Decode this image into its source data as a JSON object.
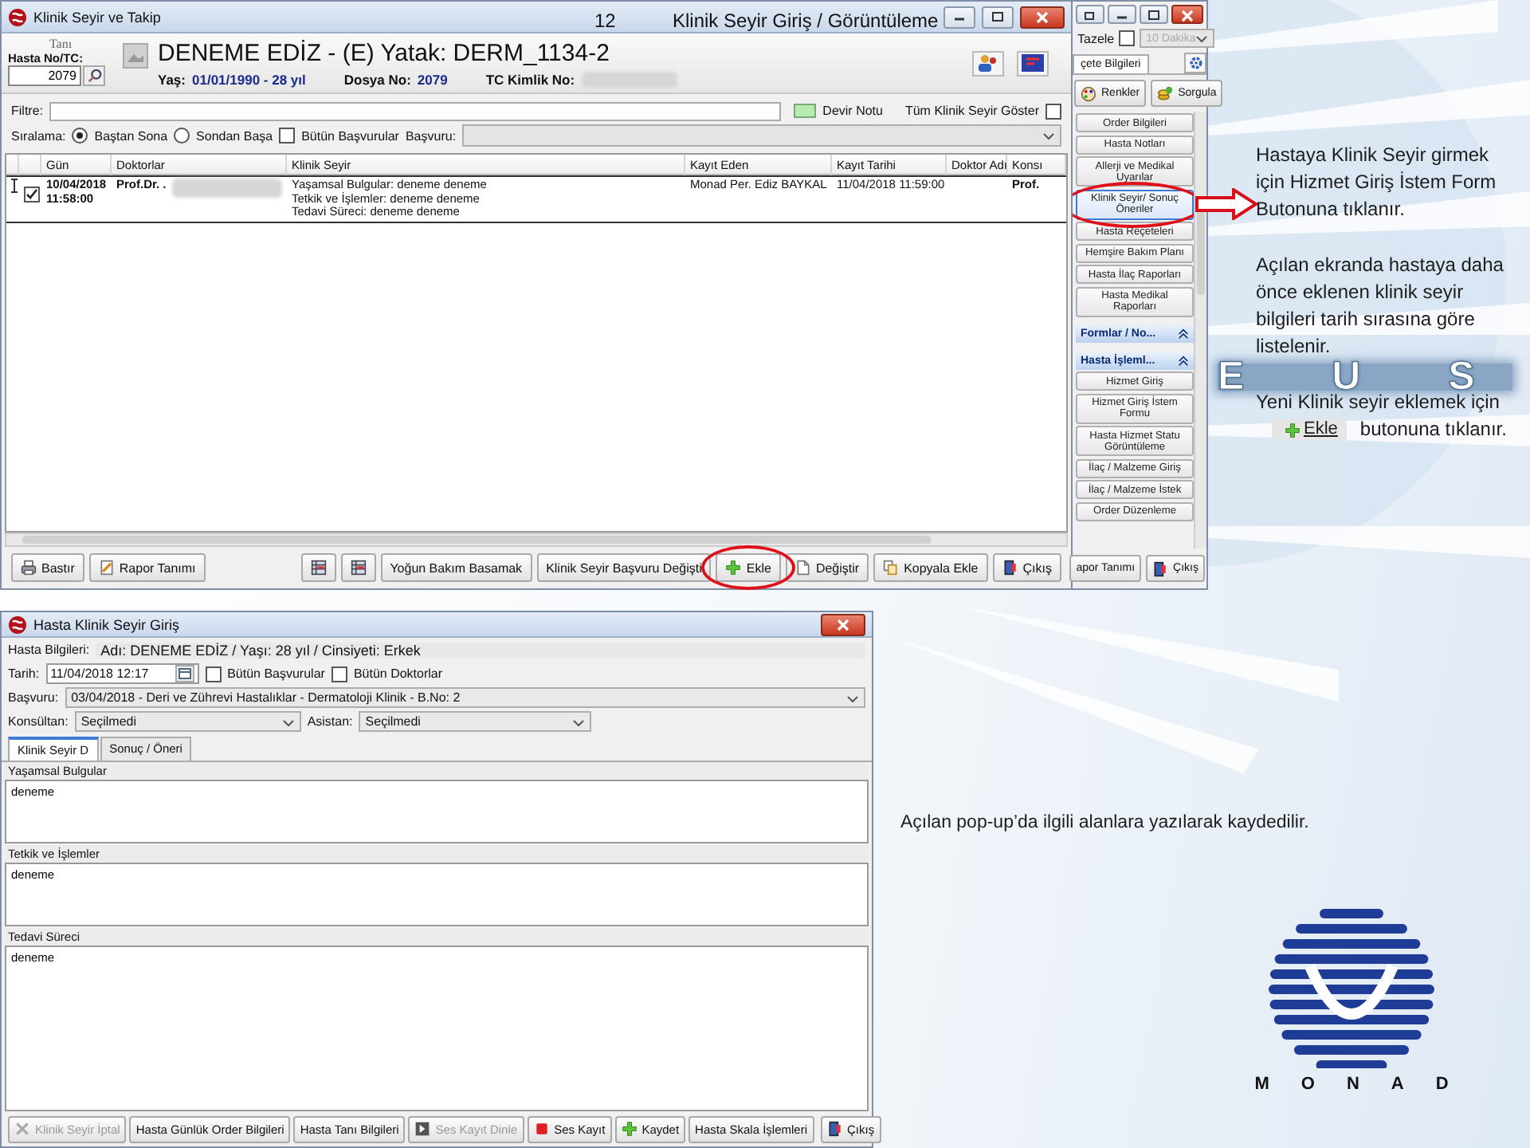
{
  "slide": {
    "number": "12",
    "title": "Klinik Seyir Giriş / Görüntüleme",
    "background_letters": "E U S"
  },
  "main_window": {
    "title": "Klinik Seyir ve Takip",
    "header": {
      "diagnosis_label": "Tanı",
      "patient_no_label": "Hasta No/TC:",
      "patient_no": "2079",
      "patient_title": "DENEME EDİZ - (E) Yatak: DERM_1134-2",
      "info": [
        {
          "label": "Yaş:",
          "value": "01/01/1990 - 28 yıl",
          "redacted": false
        },
        {
          "label": "Dosya No:",
          "value": "2079",
          "redacted": false
        },
        {
          "label": "TC Kimlik No:",
          "redacted": true
        }
      ]
    },
    "filter": {
      "label": "Filtre:",
      "legend": "Devir Notu",
      "show_all": {
        "label": "Tüm Klinik Seyir Göster",
        "checked": false
      }
    },
    "sort": {
      "label": "Sıralama:",
      "options": [
        {
          "label": "Baştan Sona",
          "selected": true
        },
        {
          "label": "Sondan Başa",
          "selected": false
        }
      ],
      "all_applications": {
        "label": "Bütün Başvurular",
        "checked": false
      },
      "application_label": "Başvuru:"
    },
    "table": {
      "columns": [
        "Gün",
        "Doktorlar",
        "Klinik Seyir",
        "Kayıt Eden",
        "Kayıt Tarihi",
        "Doktor Adı",
        "Konsı"
      ],
      "rows": [
        {
          "selected": true,
          "checked": true,
          "day": "10/04/2018 11:58:00",
          "doctor": "Prof.Dr. .",
          "doctor_redacted": true,
          "course": [
            "Yaşamsal Bulgular: deneme deneme",
            "Tetkik ve İşlemler: deneme deneme",
            "Tedavi Süreci: deneme deneme"
          ],
          "recorded_by": "Monad Per. Ediz BAYKAL",
          "record_date": "11/04/2018 11:59:00",
          "consultant": "Prof."
        }
      ]
    },
    "toolbar": [
      {
        "kind": "button",
        "label": "Bastır",
        "highlighted": false
      },
      {
        "kind": "button",
        "label": "Rapor Tanımı",
        "highlighted": false
      },
      {
        "kind": "spacer"
      },
      {
        "kind": "icon_button",
        "highlighted": false
      },
      {
        "kind": "icon_button",
        "highlighted": false
      },
      {
        "kind": "button",
        "label": "Yoğun Bakım Basamak",
        "highlighted": false
      },
      {
        "kind": "button",
        "label": "Klinik Seyir Başvuru Değişti",
        "highlighted": false
      },
      {
        "kind": "button",
        "label": "Ekle",
        "highlighted": true
      },
      {
        "kind": "button",
        "label": "Değiştir",
        "highlighted": false
      },
      {
        "kind": "button",
        "label": "Kopyala Ekle",
        "highlighted": false
      },
      {
        "kind": "button",
        "label": "Çıkış",
        "highlighted": false
      }
    ]
  },
  "side_panel": {
    "refresh_label": "Tazele",
    "refresh_checked": false,
    "interval": "10 Dakika",
    "interval_disabled": true,
    "tab": "çete Bilgileri",
    "buttons": [
      {
        "label": "Renkler"
      },
      {
        "label": "Sorgula"
      }
    ],
    "items": [
      {
        "kind": "button",
        "label": "Order Bilgileri",
        "highlighted": false
      },
      {
        "kind": "button",
        "label": "Hasta Notları",
        "highlighted": false
      },
      {
        "kind": "button",
        "label": "Allerji ve Medikal Uyarılar",
        "highlighted": false
      },
      {
        "kind": "button",
        "label": "Klinik Seyir/ Sonuç Öneriler",
        "highlighted": true
      },
      {
        "kind": "button",
        "label": "Hasta Reçeteleri",
        "highlighted": false
      },
      {
        "kind": "button",
        "label": "Hemşire Bakım Planı",
        "highlighted": false
      },
      {
        "kind": "button",
        "label": "Hasta İlaç Raporları",
        "highlighted": false
      },
      {
        "kind": "button",
        "label": "Hasta Medikal Raporları",
        "highlighted": false
      },
      {
        "kind": "section",
        "label": "Formlar / No..."
      },
      {
        "kind": "section",
        "label": "Hasta İşleml..."
      },
      {
        "kind": "button",
        "label": "Hizmet Giriş",
        "highlighted": false
      },
      {
        "kind": "button",
        "label": "Hizmet Giriş İstem Formu",
        "highlighted": false
      },
      {
        "kind": "button",
        "label": "Hasta Hizmet Statu Görüntüleme",
        "highlighted": false
      },
      {
        "kind": "button",
        "label": "İlaç / Malzeme Giriş",
        "highlighted": false
      },
      {
        "kind": "button",
        "label": "İlaç / Malzeme İstek",
        "highlighted": false
      },
      {
        "kind": "button",
        "label": "Order Düzenleme",
        "highlighted": false
      }
    ],
    "footer": [
      {
        "label": "apor Tanımı"
      },
      {
        "label": "Çıkış"
      }
    ]
  },
  "entry_window": {
    "title": "Hasta Klinik Seyir Giriş",
    "patient_label": "Hasta Bilgileri:",
    "patient_info": "Adı: DENEME EDİZ / Yaşı: 28 yıl / Cinsiyeti: Erkek",
    "date_label": "Tarih:",
    "date": "11/04/2018 12:17",
    "checks": [
      {
        "label": "Bütün Başvurular",
        "checked": false
      },
      {
        "label": "Bütün Doktorlar",
        "checked": false
      }
    ],
    "application_label": "Başvuru:",
    "application": "03/04/2018 - Deri ve Zührevi Hastalıklar - Dermatoloji Klinik - B.No: 2",
    "consultant_label": "Konsültan:",
    "consultant": "Seçilmedi",
    "assistant_label": "Asistan:",
    "assistant": "Seçilmedi",
    "tabs": [
      {
        "label": "Klinik Seyir D",
        "selected": true
      },
      {
        "label": "Sonuç / Öneri",
        "selected": false
      }
    ],
    "sections": [
      {
        "label": "Yaşamsal Bulgular",
        "value": "deneme"
      },
      {
        "label": "Tetkik ve İşlemler",
        "value": "deneme"
      },
      {
        "label": "Tedavi Süreci",
        "value": "deneme"
      }
    ],
    "toolbar": [
      {
        "kind": "button",
        "label": "Klinik Seyir İptal",
        "disabled": true
      },
      {
        "kind": "button",
        "label": "Hasta Günlük Order Bilgileri",
        "disabled": false
      },
      {
        "kind": "button",
        "label": "Hasta Tanı Bilgileri",
        "disabled": false
      },
      {
        "kind": "button",
        "label": "Ses Kayıt Dinle",
        "disabled": true
      },
      {
        "kind": "button",
        "label": "Ses Kayıt",
        "disabled": false
      },
      {
        "kind": "button",
        "label": "Kaydet",
        "disabled": false
      },
      {
        "kind": "button",
        "label": "Hasta Skala İşlemleri",
        "disabled": false
      },
      {
        "kind": "spacer"
      },
      {
        "kind": "button",
        "label": "Çıkış",
        "disabled": false
      }
    ]
  },
  "notes": [
    {
      "kind": "text",
      "text": "Hastaya Klinik Seyir girmek için  Hizmet Giriş İstem Form Butonuna tıklanır."
    },
    {
      "kind": "text",
      "text": "Açılan ekranda hastaya daha önce eklenen klinik seyir bilgileri tarih sırasına göre listelenir."
    },
    {
      "kind": "inline_button",
      "before": "Yeni Klinik seyir eklemek için",
      "button": "Ekle",
      "after": "butonuna tıklanır."
    }
  ],
  "caption": "Açılan pop-up’da ilgili alanlara yazılarak kaydedilir.",
  "logo": {
    "name": "MONAD"
  }
}
